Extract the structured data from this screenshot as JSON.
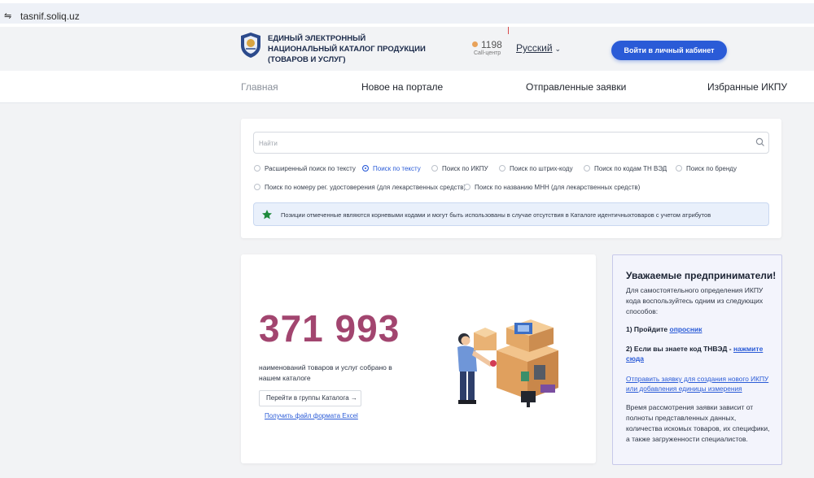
{
  "browser": {
    "url": "tasnif.soliq.uz"
  },
  "header": {
    "brand": "ЕДИНЫЙ ЭЛЕКТРОННЫЙ НАЦИОНАЛЬНЫЙ КАТАЛОГ ПРОДУКЦИИ (ТОВАРОВ И УСЛУГ)",
    "brand_lines": [
      "ЕДИНЫЙ ЭЛЕКТРОННЫЙ",
      "НАЦИОНАЛЬНЫЙ КАТАЛОГ ПРОДУКЦИИ",
      "(ТОВАРОВ И УСЛУГ)"
    ],
    "call_number": "1198",
    "call_label": "Call-центр",
    "language": "Русский",
    "login_label": "Войти в личный кабинет"
  },
  "nav": {
    "items": [
      "Главная",
      "Новое на портале",
      "Отправленные заявки",
      "Избранные ИКПУ"
    ]
  },
  "search": {
    "placeholder": "Найти",
    "options": [
      "Расширенный поиск по тексту",
      "Поиск по тексту",
      "Поиск по ИКПУ",
      "Поиск по штрих-коду",
      "Поиск по кодам ТН ВЭД",
      "Поиск по бренду",
      "Поиск по номеру рег. удостоверения (для лекарственных средств)",
      "Поиск по названию МНН (для лекарственных средств)"
    ],
    "selected": "Поиск по тексту",
    "notice": "Позиции отмеченные являются корневыми кодами и могут быть использованы в случае отсутствия в Каталоге идентичныхтоваров с учетом атрибутов"
  },
  "stats": {
    "count": "371 993",
    "description": "наименований товаров и услуг собрано в нашем каталоге",
    "goto_label": "Перейти в группы Каталога",
    "excel_link": "Получить файл формата Excel"
  },
  "info": {
    "title": "Уважаемые предприниматели!",
    "intro": "Для самостоятельного определения ИКПУ кода воспользуйтесь одним из следующих способов:",
    "step1_prefix": "1)  Пройдите ",
    "step1_link": "опросник",
    "step2_prefix": "2)  Если вы знаете код ТНВЭД - ",
    "step2_link": "нажмите сюда",
    "request_link": "Отправить заявку для создания нового ИКПУ или добавления единицы измерения",
    "review_note": "Время рассмотрения заявки зависит от полноты представленных данных, количества искомых товаров, их специфики, а также загруженности специалистов."
  },
  "colors": {
    "accent_blue": "#2a5bd7",
    "count_color": "#a2456f",
    "notice_bg": "#e9f0fb",
    "info_border": "#c7c9ea"
  }
}
